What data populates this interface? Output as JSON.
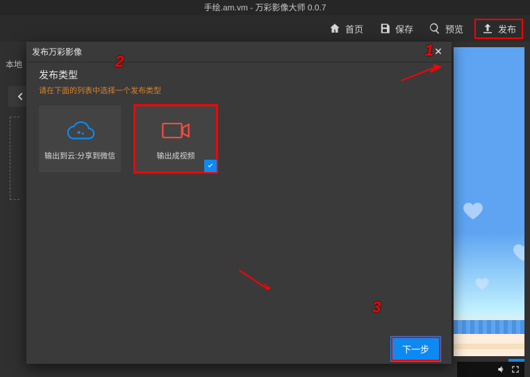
{
  "titlebar": {
    "text": "手绘.am.vm - 万彩影像大师 0.0.7"
  },
  "toolbar": {
    "home": "首页",
    "save": "保存",
    "preview": "预览",
    "publish": "发布"
  },
  "left": {
    "hint": "本地"
  },
  "modal": {
    "title": "发布万彩影像",
    "section_title": "发布类型",
    "section_hint": "请在下面的列表中选择一个发布类型",
    "cards": {
      "cloud": "输出到云:分享到微信",
      "video": "输出成视频"
    },
    "next": "下一步"
  },
  "badges": {
    "one": "1",
    "two": "2",
    "three": "3"
  }
}
